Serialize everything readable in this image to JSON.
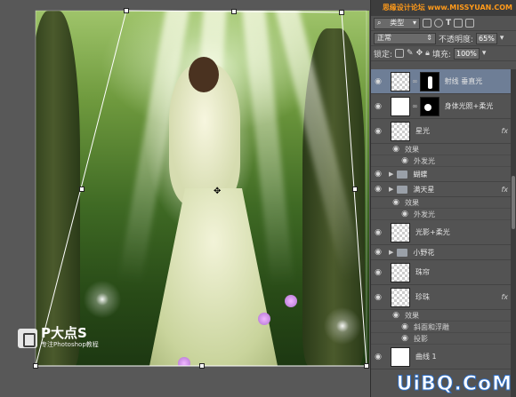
{
  "canvas": {
    "watermark_title": "P大点S",
    "watermark_subtitle": "专注Photoshop教程"
  },
  "panel": {
    "site_strip": "思缘设计论坛 www.MISSYUAN.COM",
    "filter_kind": "类型",
    "blend_mode": "正常",
    "opacity_label": "不透明度:",
    "opacity_value": "65%",
    "lock_label": "锁定:",
    "fill_label": "填充:",
    "fill_value": "100%",
    "layers": [
      {
        "type": "layer",
        "name": "射线 垂直光",
        "selected": true,
        "thumb": "checker",
        "mask": "figure"
      },
      {
        "type": "layer",
        "name": "身体光照+柔光",
        "thumb": "white",
        "mask": "dot"
      },
      {
        "type": "layer",
        "name": "星光",
        "thumb": "checker",
        "fx": "fx"
      },
      {
        "type": "effect",
        "name": "效果"
      },
      {
        "type": "effect",
        "name": "外发光"
      },
      {
        "type": "group",
        "name": "蝴蝶"
      },
      {
        "type": "group",
        "name": "满天星",
        "fx": "fx"
      },
      {
        "type": "effect",
        "name": "效果"
      },
      {
        "type": "effect",
        "name": "外发光"
      },
      {
        "type": "layer",
        "name": "光影+柔光",
        "thumb": "checker"
      },
      {
        "type": "group",
        "name": "小野花"
      },
      {
        "type": "layer",
        "name": "珠帘",
        "thumb": "checker"
      },
      {
        "type": "layer",
        "name": "珍珠",
        "thumb": "checker",
        "fx": "fx"
      },
      {
        "type": "effect",
        "name": "效果"
      },
      {
        "type": "effect",
        "name": "斜面和浮雕"
      },
      {
        "type": "effect",
        "name": "投影"
      },
      {
        "type": "layer",
        "name": "曲线 1",
        "thumb": "white"
      }
    ]
  },
  "corner_logo": "UiBQ.CoM"
}
